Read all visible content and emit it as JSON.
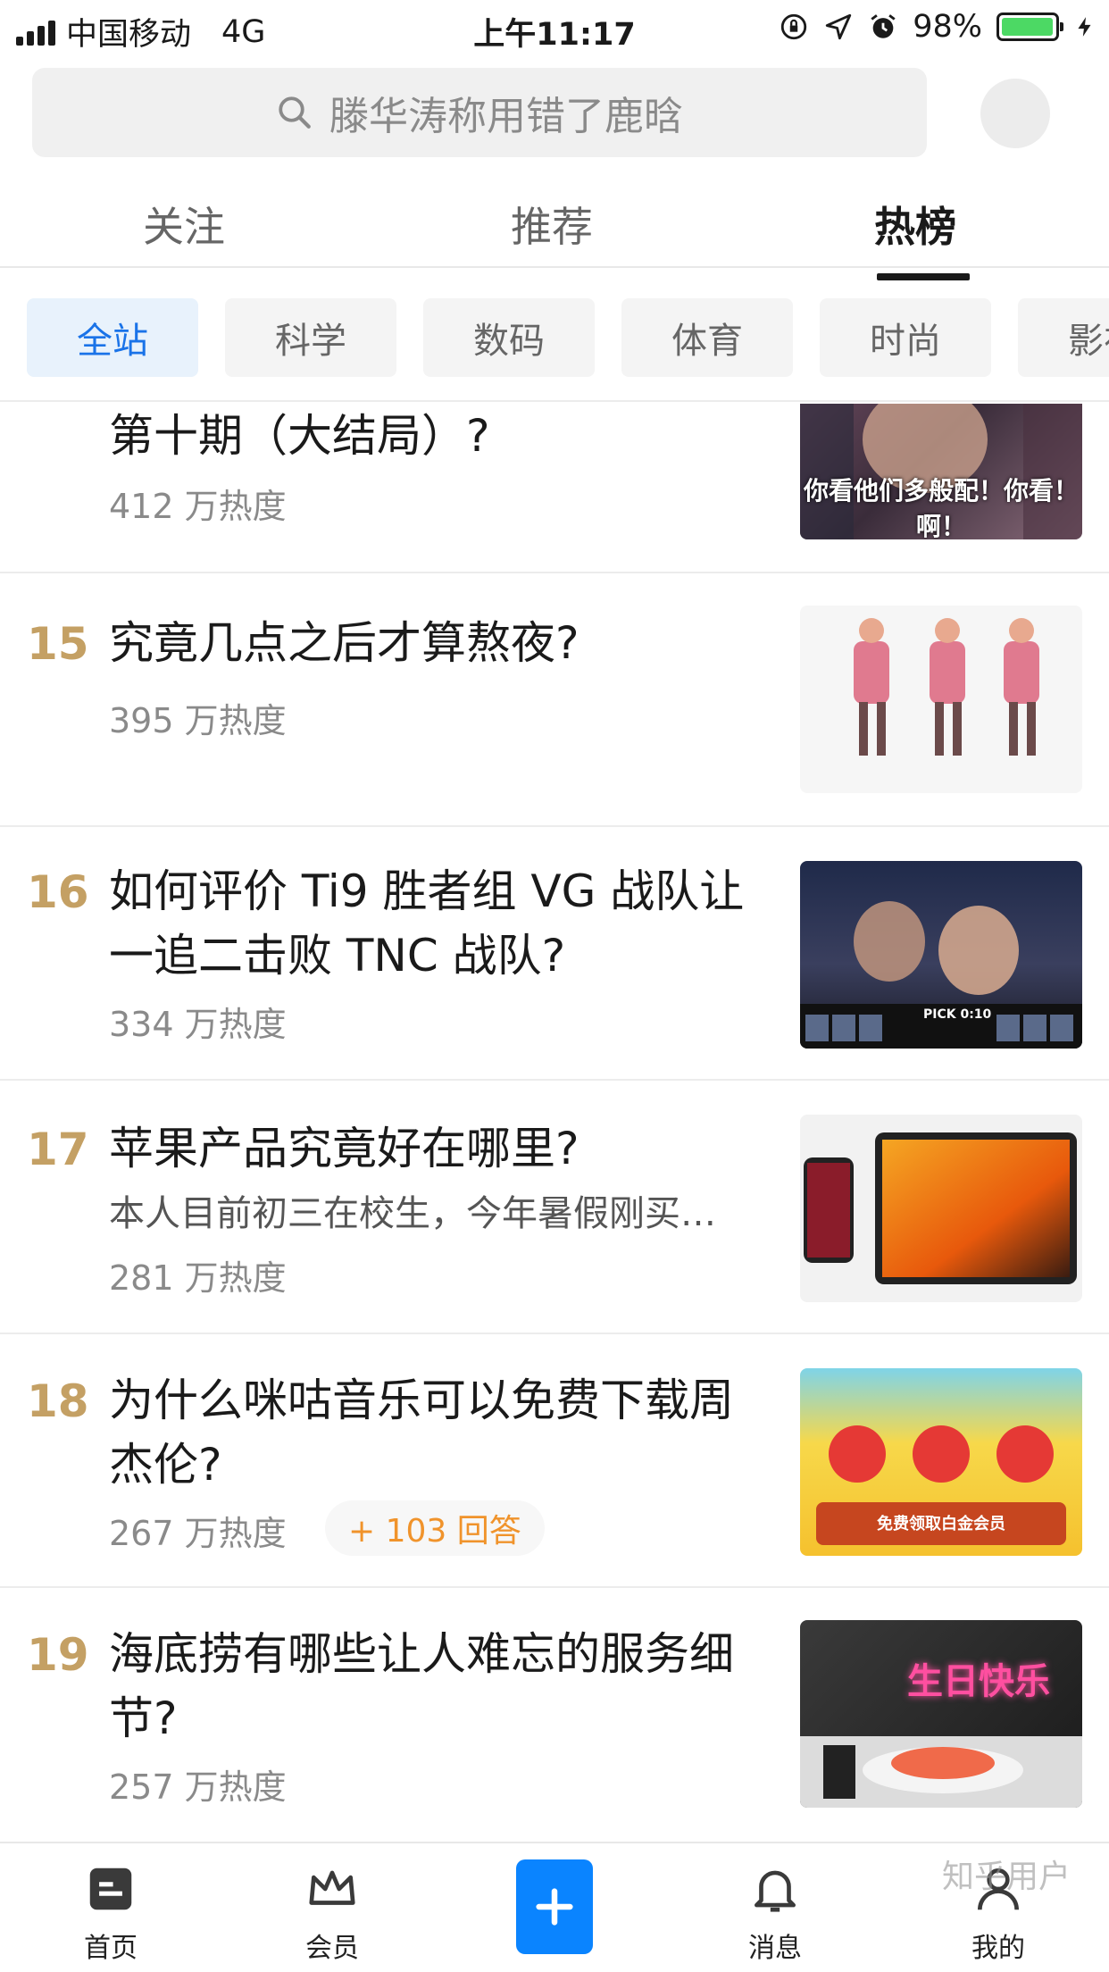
{
  "status_bar": {
    "carrier": "中国移动",
    "network": "4G",
    "time": "上午11:17",
    "battery": "98%",
    "battery_level": 0.98
  },
  "search": {
    "placeholder": "滕华涛称用错了鹿晗"
  },
  "top_tabs": [
    {
      "label": "关注"
    },
    {
      "label": "推荐"
    },
    {
      "label": "热榜"
    }
  ],
  "active_top_tab": "热榜",
  "categories": [
    {
      "label": "全站"
    },
    {
      "label": "科学"
    },
    {
      "label": "数码"
    },
    {
      "label": "体育"
    },
    {
      "label": "时尚"
    },
    {
      "label": "影视"
    }
  ],
  "active_category": "全站",
  "items": [
    {
      "rank": "",
      "title": "第十期（大结局）?",
      "excerpt": "",
      "heat": "412 万热度",
      "answers": "",
      "thumb_caption": "你看他们多般配！你看！啊！"
    },
    {
      "rank": "15",
      "title": "究竟几点之后才算熬夜?",
      "excerpt": "",
      "heat": "395 万热度",
      "answers": "",
      "thumb_caption": ""
    },
    {
      "rank": "16",
      "title": "如何评价 Ti9 胜者组 VG 战队让一追二击败 TNC 战队?",
      "excerpt": "",
      "heat": "334 万热度",
      "answers": "",
      "thumb_caption": "PICK 0:10"
    },
    {
      "rank": "17",
      "title": "苹果产品究竟好在哪里?",
      "excerpt": "本人目前初三在校生，今年暑假刚买…",
      "heat": "281 万热度",
      "answers": "",
      "thumb_caption": ""
    },
    {
      "rank": "18",
      "title": "为什么咪咕音乐可以免费下载周杰伦?",
      "excerpt": "",
      "heat": "267 万热度",
      "answers": "+ 103 回答",
      "thumb_caption": "免费领取白金会员"
    },
    {
      "rank": "19",
      "title": "海底捞有哪些让人难忘的服务细节?",
      "excerpt": "",
      "heat": "257 万热度",
      "answers": "",
      "thumb_caption": "生日快乐"
    }
  ],
  "bottom_nav": [
    {
      "label": "首页",
      "icon": "home-icon"
    },
    {
      "label": "会员",
      "icon": "crown-icon"
    },
    {
      "label": "",
      "icon": "plus-icon"
    },
    {
      "label": "消息",
      "icon": "bell-icon"
    },
    {
      "label": "我的",
      "icon": "person-icon"
    }
  ],
  "watermark": "知乎用户",
  "colors": {
    "accent": "#0a84ff",
    "rank": "#c4a064",
    "chip_active_bg": "#e8f2fc",
    "chip_active_text": "#1a73e8",
    "answers_text": "#f0932b",
    "battery": "#4cd964"
  }
}
